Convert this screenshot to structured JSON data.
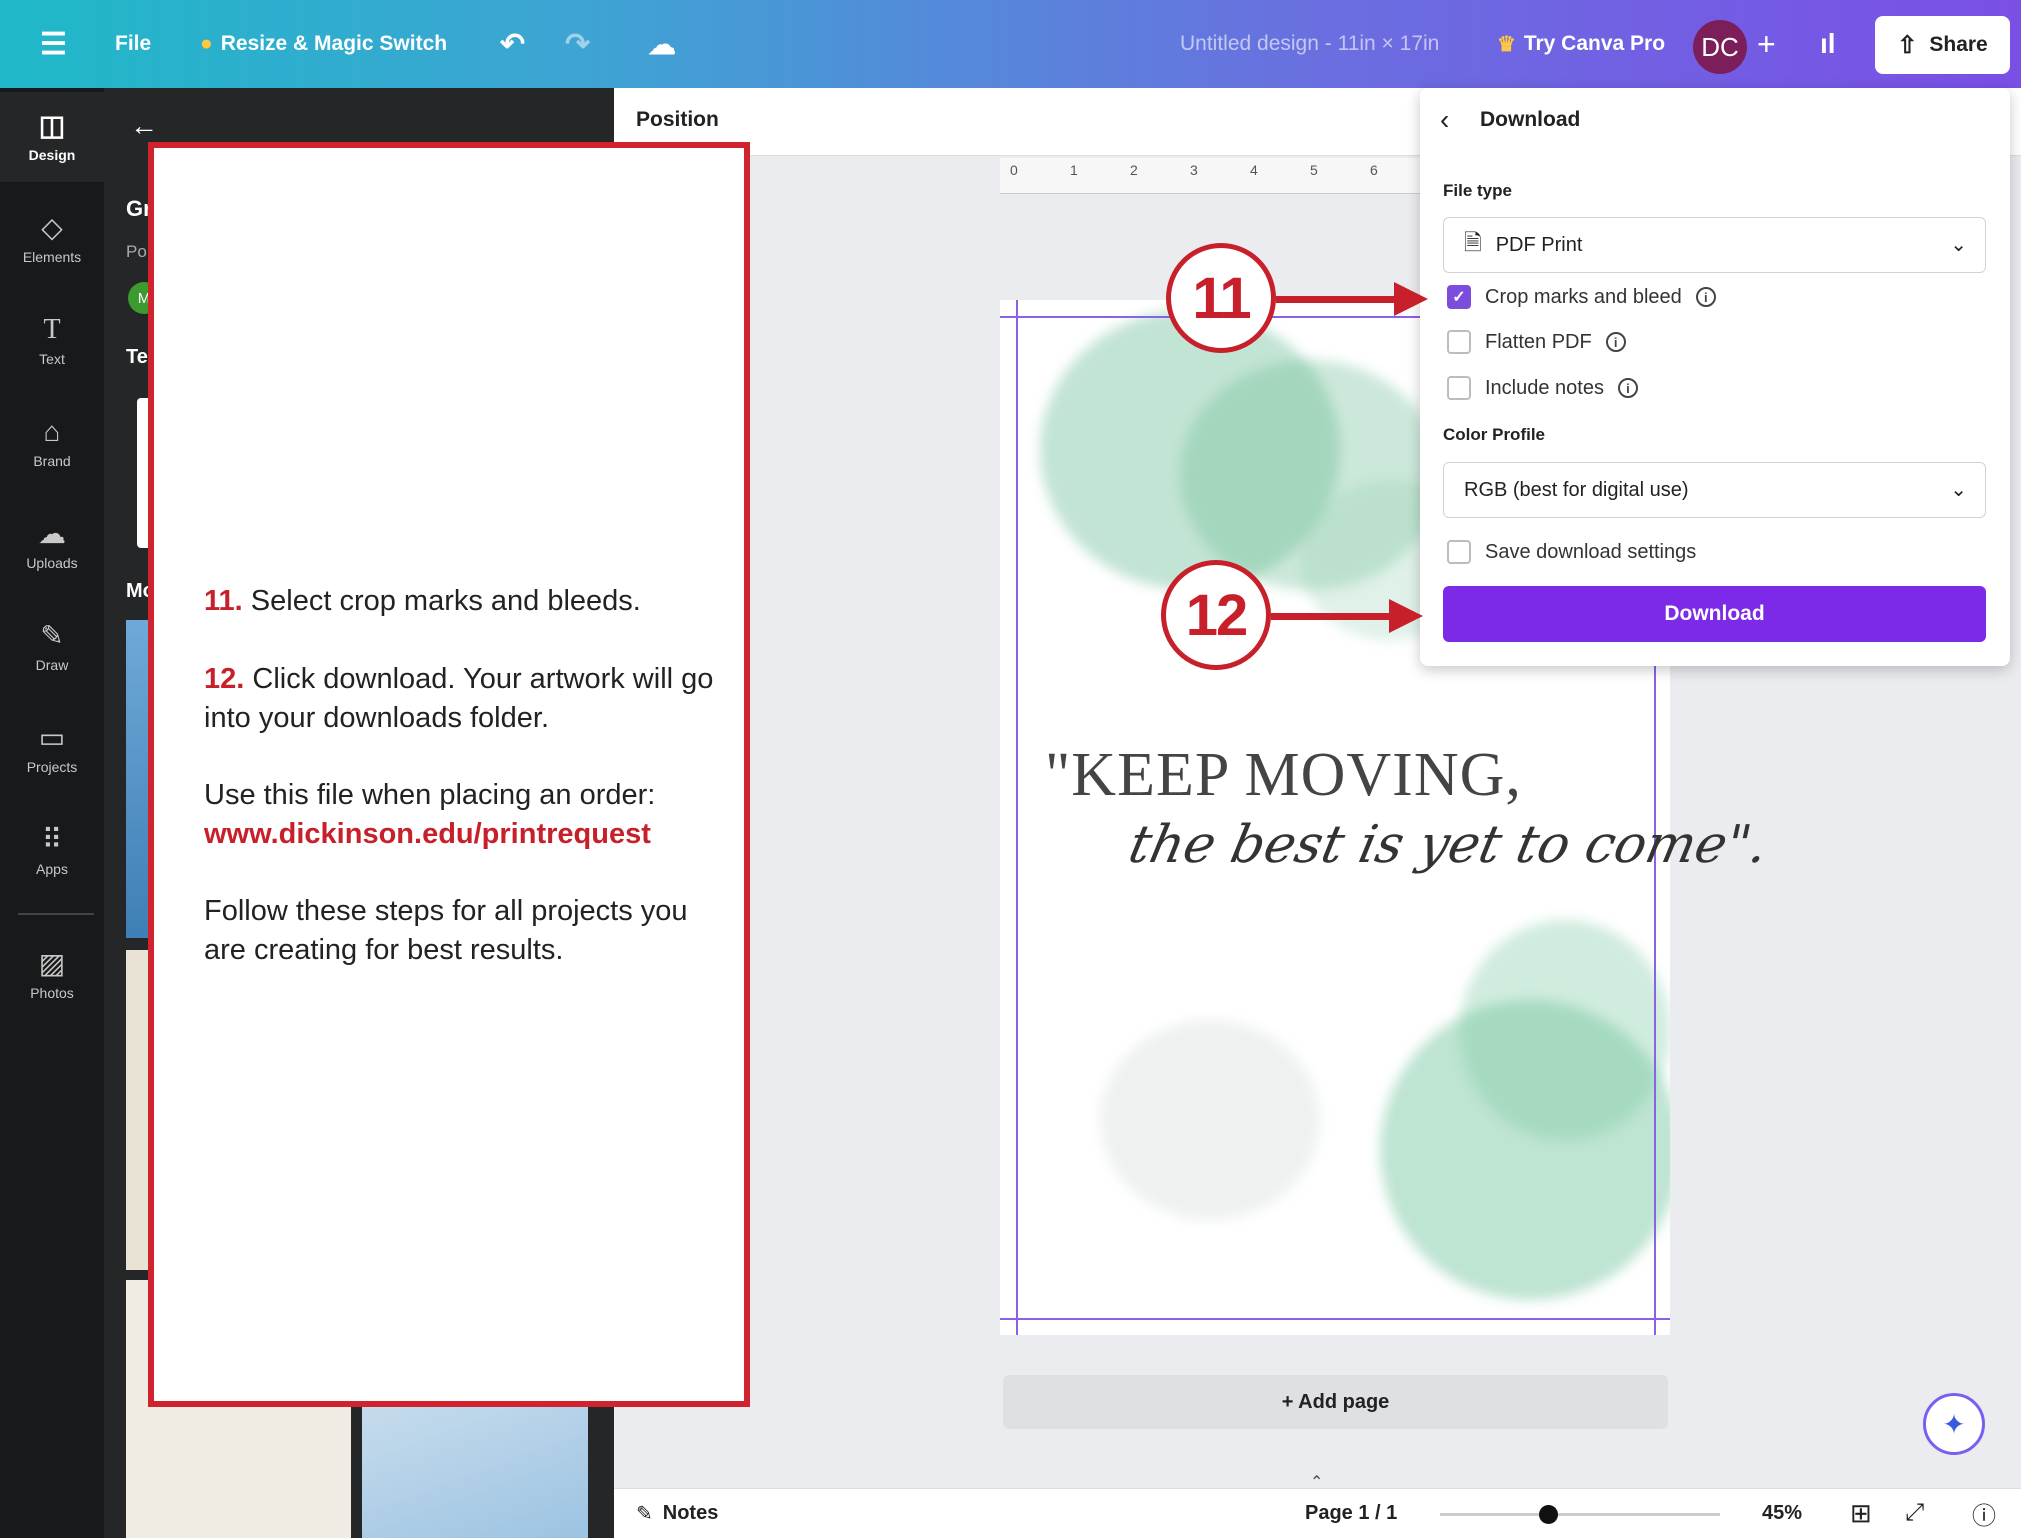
{
  "topbar": {
    "menu_icon": "hamburger-icon",
    "file": "File",
    "resize": "Resize & Magic Switch",
    "design_title": "Untitled design - 11in × 17in",
    "try_pro": "Try Canva Pro",
    "avatar_initials": "DC",
    "plus": "+",
    "share": "Share"
  },
  "rail": {
    "items": [
      {
        "label": "Design",
        "icon": "layout-icon"
      },
      {
        "label": "Elements",
        "icon": "shapes-icon"
      },
      {
        "label": "Text",
        "icon": "text-icon"
      },
      {
        "label": "Brand",
        "icon": "brand-icon"
      },
      {
        "label": "Uploads",
        "icon": "cloud-upload-icon"
      },
      {
        "label": "Draw",
        "icon": "pen-icon"
      },
      {
        "label": "Projects",
        "icon": "folder-icon"
      },
      {
        "label": "Apps",
        "icon": "grid-icon"
      },
      {
        "label": "Photos",
        "icon": "image-icon"
      }
    ]
  },
  "sidepanel": {
    "partial_texts": [
      "Gr",
      "Po",
      "M",
      "Te",
      "Mo"
    ]
  },
  "canvas": {
    "position_label": "Position",
    "ruler_ticks": [
      "0",
      "1",
      "2",
      "3",
      "4",
      "5",
      "6"
    ],
    "quote_line1": "\"KEEP MOVING,",
    "quote_line2": "the best is yet to come\".",
    "add_page": "+ Add page"
  },
  "download_panel": {
    "title": "Download",
    "file_type_label": "File type",
    "file_type_value": "PDF Print",
    "options": [
      {
        "label": "Crop marks and bleed",
        "checked": true
      },
      {
        "label": "Flatten PDF",
        "checked": false
      },
      {
        "label": "Include notes",
        "checked": false
      }
    ],
    "color_profile_label": "Color Profile",
    "color_profile_value": "RGB (best for digital use)",
    "save_settings": "Save download settings",
    "save_settings_checked": false,
    "download_button": "Download"
  },
  "bottombar": {
    "notes": "Notes",
    "page_indicator": "Page 1 / 1",
    "zoom_percent": "45%",
    "zoom_level": 0.45
  },
  "callouts": {
    "step11": "11",
    "step12": "12"
  },
  "instructions": {
    "step11_num": "11.",
    "step11_text": "Select crop marks and bleeds.",
    "step12_num": "12.",
    "step12_text": "Click download. Your artwork will go into your downloads folder.",
    "use_file": "Use this file when placing an order:",
    "url": "www.dickinson.edu/printrequest",
    "follow": "Follow these steps for all projects you are creating for best results."
  },
  "colors": {
    "accent_purple": "#7d2ae8",
    "callout_red": "#c8202a"
  }
}
